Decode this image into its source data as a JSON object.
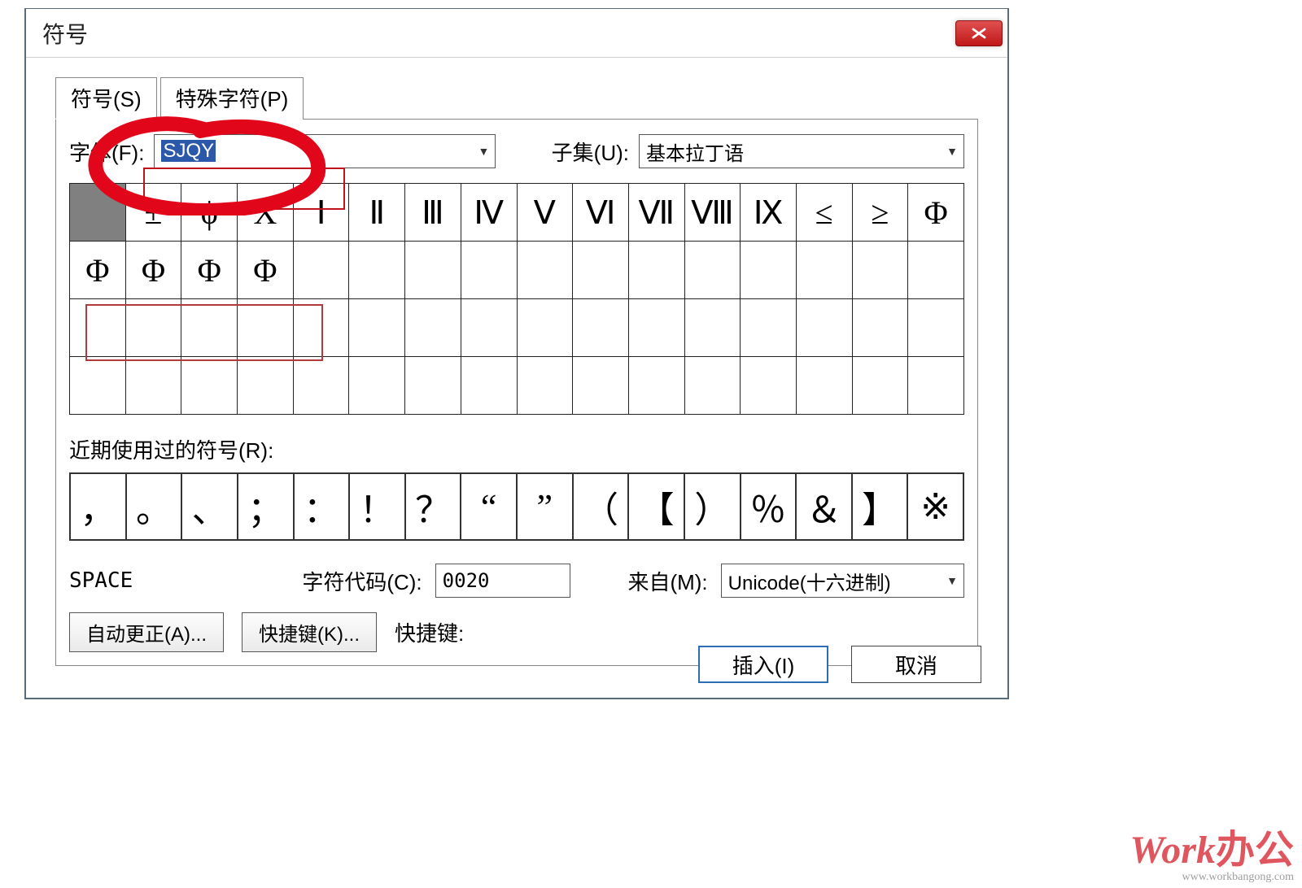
{
  "title": "符号",
  "tabs": {
    "symbols": "符号(S)",
    "special": "特殊字符(P)"
  },
  "font": {
    "label": "字体(F):",
    "value": "SJQY"
  },
  "subset": {
    "label": "子集(U):",
    "value": "基本拉丁语"
  },
  "grid_rows": [
    [
      "",
      "±",
      "ϕ",
      "X",
      "Ⅰ",
      "Ⅱ",
      "Ⅲ",
      "Ⅳ",
      "Ⅴ",
      "Ⅵ",
      "Ⅶ",
      "Ⅷ",
      "Ⅸ",
      "≤",
      "≥",
      "Φ"
    ],
    [
      "Φ",
      "Φ",
      "Φ",
      "Φ",
      "",
      "",
      "",
      "",
      "",
      "",
      "",
      "",
      "",
      "",
      "",
      ""
    ],
    [
      "",
      "",
      "",
      "",
      "",
      "",
      "",
      "",
      "",
      "",
      "",
      "",
      "",
      "",
      "",
      ""
    ],
    [
      "",
      "",
      "",
      "",
      "",
      "",
      "",
      "",
      "",
      "",
      "",
      "",
      "",
      "",
      "",
      ""
    ]
  ],
  "recent": {
    "label": "近期使用过的符号(R):",
    "items": [
      "，",
      "。",
      "、",
      "；",
      "：",
      "！",
      "？",
      "“",
      "”",
      "（",
      "【",
      "）",
      "％",
      "＆",
      "】",
      "※"
    ]
  },
  "char_name": "SPACE",
  "char_code": {
    "label": "字符代码(C):",
    "value": "0020"
  },
  "from": {
    "label": "来自(M):",
    "value": "Unicode(十六进制)"
  },
  "autocorrect_btn": "自动更正(A)...",
  "shortcut_btn": "快捷键(K)...",
  "shortcut_label": "快捷键:",
  "insert_btn": "插入(I)",
  "cancel_btn": "取消",
  "watermark": {
    "brand_en": "Work",
    "brand_cn": "办公",
    "url": "www.workbangong.com"
  }
}
